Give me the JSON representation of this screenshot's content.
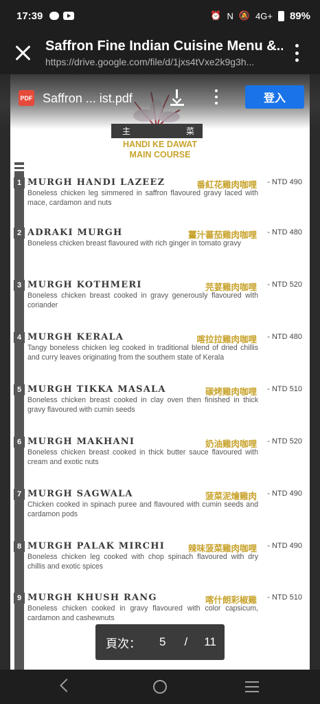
{
  "status_bar": {
    "time": "17:39",
    "network": "4G+",
    "battery": "89%"
  },
  "app_bar": {
    "title": "Saffron Fine Indian Cuisine Menu &...",
    "url": "https://drive.google.com/file/d/1jxs4tVxe2k9g3h..."
  },
  "viewer": {
    "pdf_badge": "PDF",
    "file_name": "Saffron ... ist.pdf",
    "login_label": "登入"
  },
  "menu": {
    "banner_left": "主",
    "banner_right": "菜",
    "section_title_1": "HANDI KE DAWAT",
    "section_title_2": "MAIN COURSE",
    "items": [
      {
        "num": "1",
        "name": "MURGH HANDI LAZEEZ",
        "cn": "番紅花雞肉咖哩",
        "price": "- NTD 490",
        "desc": "Boneless chicken leg simmered in saffron flavoured gravy laced with mace, cardamon and nuts"
      },
      {
        "num": "2",
        "name": "ADRAKI MURGH",
        "cn": "薑汁蕃茄雞肉咖哩",
        "price": "- NTD 480",
        "desc": "Boneless chicken breast flavoured with rich ginger in tomato gravy"
      },
      {
        "num": "3",
        "name": "MURGH KOTHMERI",
        "cn": "芫荽雞肉咖哩",
        "price": "- NTD 520",
        "desc": "Boneless chicken breast cooked in gravy generously flavoured with coriander"
      },
      {
        "num": "4",
        "name": "MURGH KERALA",
        "cn": "喀拉拉雞肉咖哩",
        "price": "- NTD 480",
        "desc": "Tangy boneless chicken leg cooked in traditional blend of dried chillis and curry leaves originating from the southem state of Kerala"
      },
      {
        "num": "5",
        "name": "MURGH TIKKA MASALA",
        "cn": "碳烤雞肉咖哩",
        "price": "- NTD 510",
        "desc": "Boneless chicken breast cooked in clay oven then finished in thick gravy flavoured with cumin seeds"
      },
      {
        "num": "6",
        "name": "MURGH MAKHANI",
        "cn": "奶油雞肉咖哩",
        "price": "- NTD 520",
        "desc": "Boneless chicken breast cooked in thick butter sauce flavoured with cream and exotic nuts"
      },
      {
        "num": "7",
        "name": "MURGH SAGWALA",
        "cn": "菠菜泥燴雞肉",
        "price": "- NTD 490",
        "desc": "Chicken cooked in spinach puree and flavoured with cumin seeds and cardamon pods"
      },
      {
        "num": "8",
        "name": "MURGH PALAK MIRCHI",
        "cn": "辣味菠菜雞肉咖哩",
        "price": "- NTD 490",
        "desc": "Boneless chicken leg cooked with chop spinach flavoured with dry chillis and exotic spices"
      },
      {
        "num": "9",
        "name": "MURGH KHUSH RANG",
        "cn": "喀什朗彩椒雞",
        "price": "- NTD 510",
        "desc": "Boneless chicken cooked in gravy flavoured with color capsicum, cardamon and cashewnuts"
      }
    ]
  },
  "page_indicator": {
    "label": "頁次：",
    "current": "5",
    "separator": "/",
    "total": "11"
  },
  "colors": {
    "accent_gold": "#c8a32c",
    "login_blue": "#1a73e8",
    "dark_bar": "#1e1e1e"
  },
  "icons": [
    "close-icon",
    "more-vert-icon",
    "pdf-icon",
    "download-icon",
    "back-icon",
    "home-icon",
    "recents-icon"
  ]
}
